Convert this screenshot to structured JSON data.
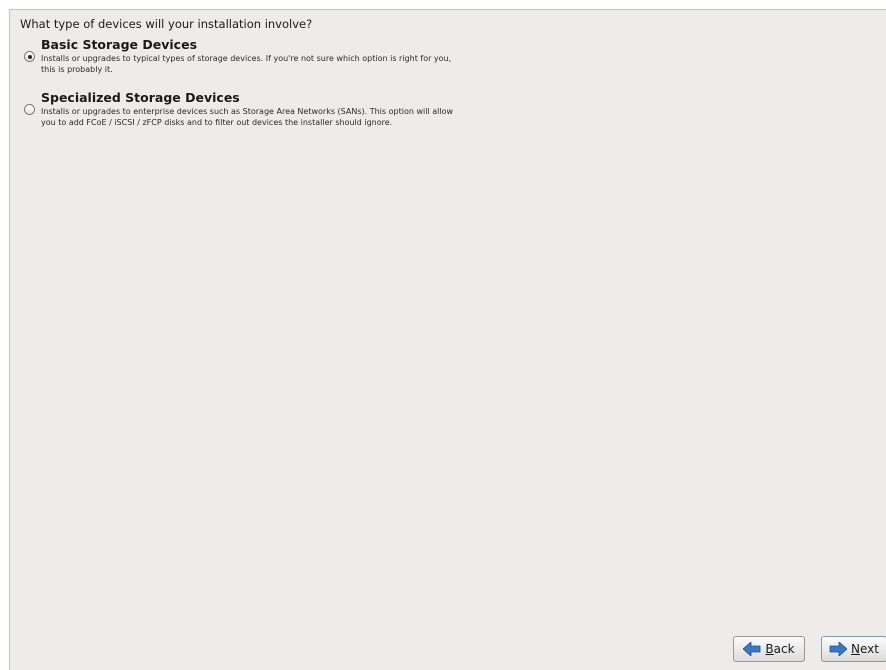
{
  "question": "What type of devices will your installation involve?",
  "options": [
    {
      "title": "Basic Storage Devices",
      "description_line1": "Installs or upgrades to typical types of storage devices.  If you're not sure which option is right for you,",
      "description_line2": "this is probably it.",
      "selected": true
    },
    {
      "title": "Specialized Storage Devices",
      "description_line1": "Installs or upgrades to enterprise devices such as Storage Area Networks (SANs). This option will allow",
      "description_line2": "you to add FCoE / iSCSI / zFCP disks and to filter out devices the installer should ignore.",
      "selected": false
    }
  ],
  "buttons": {
    "back_mnemonic": "B",
    "back_rest": "ack",
    "next_mnemonic": "N",
    "next_rest": "ext"
  },
  "colors": {
    "panel_background": "#edeceb",
    "arrow_blue": "#3a78c8"
  },
  "icons": {
    "back": "arrow-left-icon",
    "next": "arrow-right-icon"
  }
}
